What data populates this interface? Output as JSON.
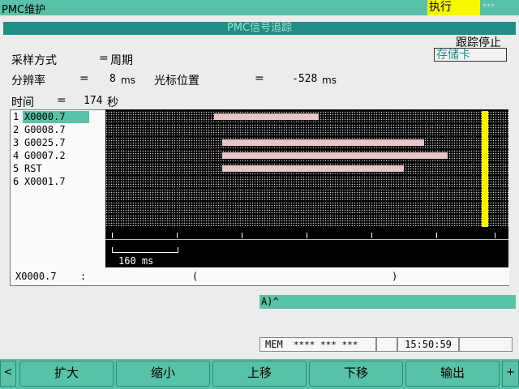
{
  "header": {
    "title": "PMC维护",
    "mode": "执行",
    "mode_stars": "***"
  },
  "screen_title": "PMC信号追踪",
  "trace_status": "跟踪停止",
  "memory_card": "存储卡",
  "settings": {
    "sampling_label": "采样方式",
    "sampling_eq": "=",
    "sampling_value": "周期",
    "resolution_label": "分辨率",
    "resolution_eq": "=",
    "resolution_value": "8",
    "resolution_unit": "ms",
    "cursor_label": "光标位置",
    "cursor_eq": "=",
    "cursor_value": "-528",
    "cursor_unit": "ms",
    "time_label": "时间",
    "time_eq": "=",
    "time_value": "174",
    "time_unit": "秒"
  },
  "signals": [
    {
      "num": "1",
      "name": "X0000.7"
    },
    {
      "num": "2",
      "name": "G0008.7"
    },
    {
      "num": "3",
      "name": "G0025.7"
    },
    {
      "num": "4",
      "name": "G0007.2"
    },
    {
      "num": "5",
      "name": "RST"
    },
    {
      "num": "6",
      "name": "X0001.7"
    }
  ],
  "trace": {
    "scale_label": "160 ms",
    "segments": [
      [
        {
          "start": 0.27,
          "end": 0.53
        }
      ],
      [],
      [
        {
          "start": 0.29,
          "end": 0.79
        }
      ],
      [
        {
          "start": 0.29,
          "end": 0.85
        }
      ],
      [
        {
          "start": 0.29,
          "end": 0.74
        }
      ],
      []
    ]
  },
  "bottom": {
    "signal": "X0000.7",
    "colon": ":",
    "open": "(",
    "close": ")"
  },
  "input_prompt": "A)^",
  "status_bar": {
    "mode": "MEM",
    "stars": "**** *** ***",
    "time": "15:50:59"
  },
  "softkeys": {
    "left_arrow": "<",
    "expand": "扩大",
    "shrink": "缩小",
    "up": "上移",
    "down": "下移",
    "output": "输出",
    "right_arrow": "+"
  }
}
